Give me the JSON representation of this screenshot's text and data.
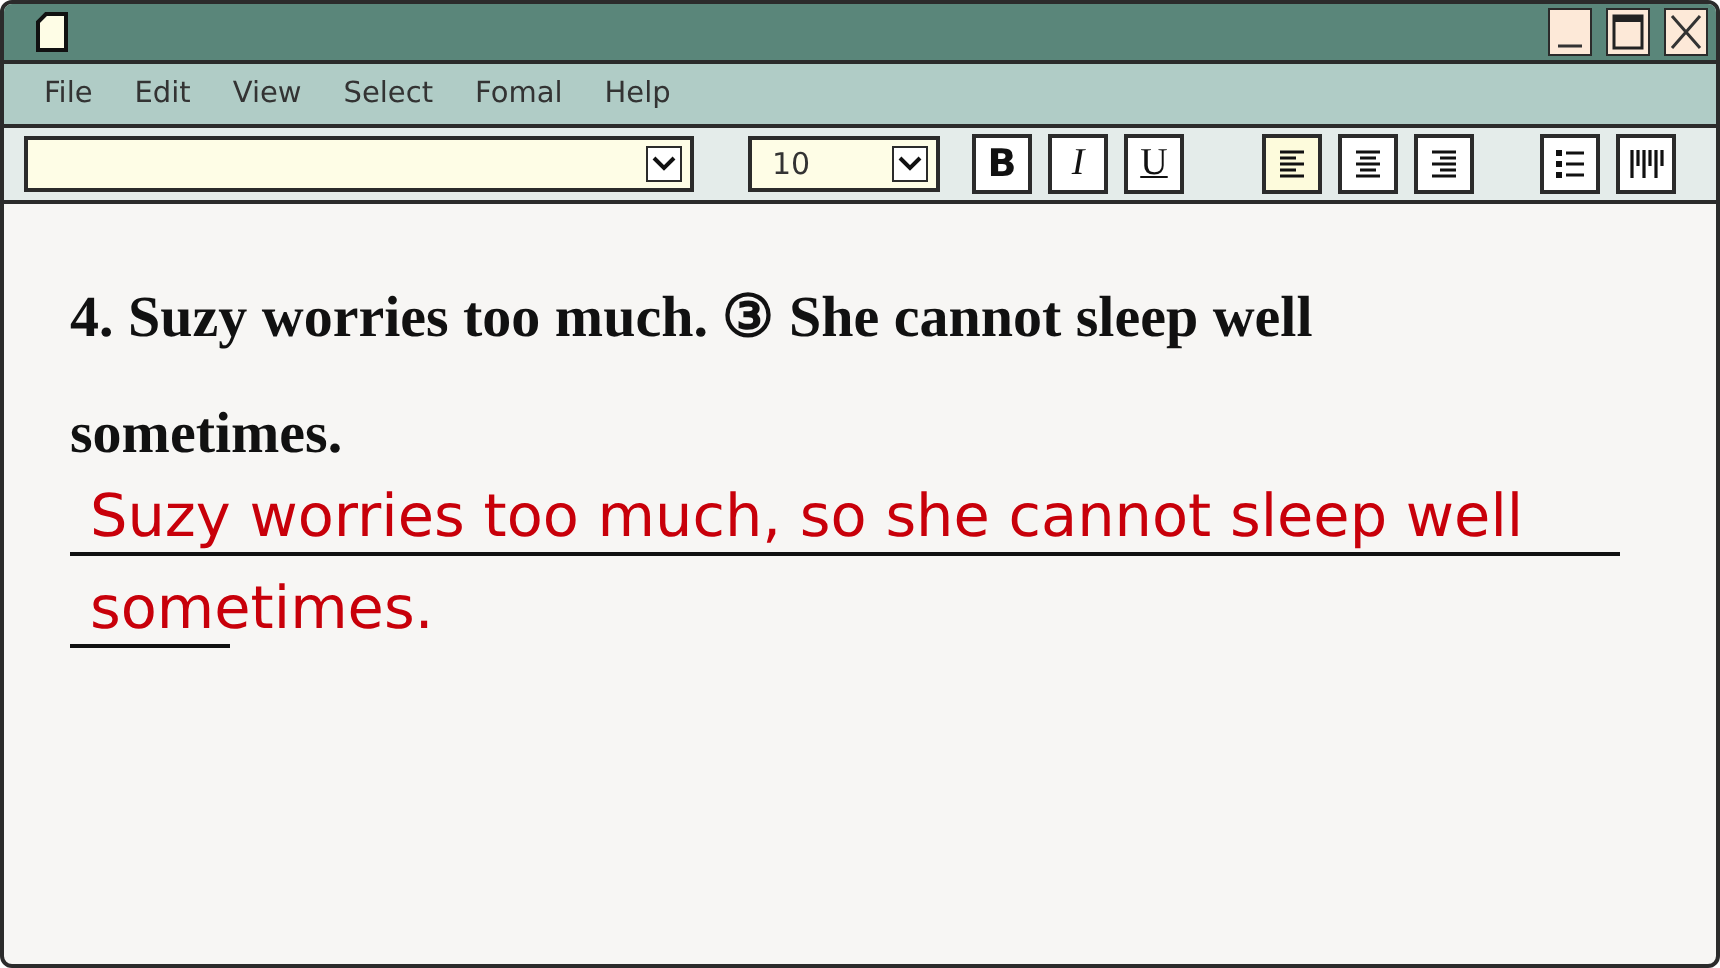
{
  "menu": [
    "File",
    "Edit",
    "View",
    "Select",
    "Fomal",
    "Help"
  ],
  "toolbar": {
    "size_field": {
      "value": "10"
    },
    "format_buttons": [
      {
        "label": "B",
        "kind": "bold"
      },
      {
        "label": "I",
        "kind": "italic"
      },
      {
        "label": "U",
        "kind": "underline"
      }
    ],
    "align_buttons": [
      {
        "kind": "left",
        "selected": true
      },
      {
        "kind": "center",
        "selected": false
      },
      {
        "kind": "right",
        "selected": false
      }
    ],
    "list_buttons": [
      {
        "kind": "bullets"
      },
      {
        "kind": "columns"
      }
    ]
  },
  "question": "4. Suzy worries too much. ③ She cannot sleep well sometimes.",
  "answer_lines": [
    "Suzy worries too much, so she cannot sleep well",
    "sometimes."
  ]
}
